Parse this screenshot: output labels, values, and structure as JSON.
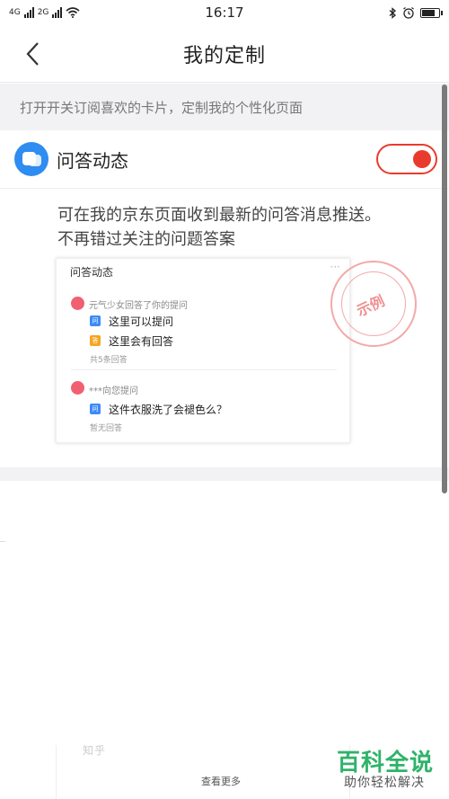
{
  "status_bar": {
    "network_1": "4G",
    "network_2": "2G",
    "time": "16:17",
    "battery_level": 0.85
  },
  "nav": {
    "title": "我的定制"
  },
  "hint": {
    "text": "打开开关订阅喜欢的卡片，定制我的个性化页面"
  },
  "card": {
    "title": "问答动态",
    "toggle_on": true,
    "description": "可在我的京东页面收到最新的问答消息推送。不再错过关注的问题答案"
  },
  "preview": {
    "title": "问答动态",
    "more": "···",
    "stamp": "示例",
    "items": [
      {
        "user": "元气少女回答了你的提问",
        "question_tag": "问",
        "question": "这里可以提问",
        "answer_tag": "答",
        "answer": "这里会有回答",
        "meta": "共5条回答"
      },
      {
        "user": "***向您提问",
        "question_tag": "问",
        "question": "这件衣服洗了会褪色么？",
        "meta": "暂无回答"
      }
    ]
  },
  "bottom": {
    "partial_label": "知乎",
    "see_more": "查看更多"
  },
  "watermark": {
    "main": "百科全说",
    "sub": "助你轻松解决"
  },
  "colors": {
    "accent": "#e93b2d",
    "icon_blue": "#2f8cf0",
    "watermark_green": "#2fb36a"
  }
}
